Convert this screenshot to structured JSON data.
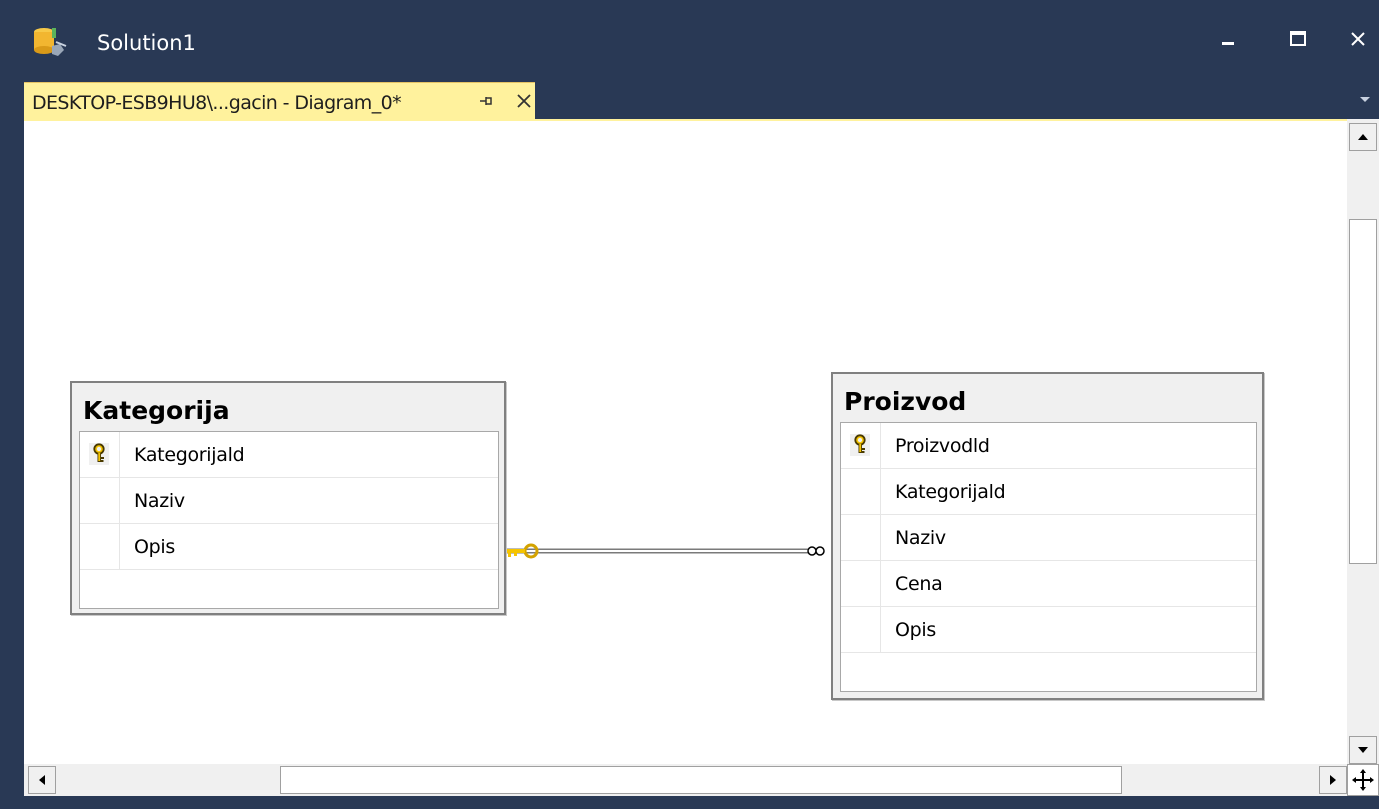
{
  "window": {
    "title": "Solution1",
    "minimize_glyph": "–",
    "maximize_glyph": "□",
    "close_glyph": "✕"
  },
  "tab": {
    "label": "DESKTOP-ESB9HU8\\...gacin - Diagram_0*",
    "pin_icon": "pin-icon",
    "close_icon": "close-icon",
    "active_color": "#fff29d"
  },
  "colors": {
    "chrome": "#293955",
    "canvas": "#ffffff",
    "key": "#f5c400"
  },
  "tables": [
    {
      "name": "Kategorija",
      "columns": [
        {
          "name": "Kategorijald",
          "primary_key": true
        },
        {
          "name": "Naziv",
          "primary_key": false
        },
        {
          "name": "Opis",
          "primary_key": false
        }
      ]
    },
    {
      "name": "Proizvod",
      "columns": [
        {
          "name": "Proizvodld",
          "primary_key": true
        },
        {
          "name": "Kategorijald",
          "primary_key": false
        },
        {
          "name": "Naziv",
          "primary_key": false
        },
        {
          "name": "Cena",
          "primary_key": false
        },
        {
          "name": "Opis",
          "primary_key": false
        }
      ]
    }
  ],
  "relationship": {
    "from": "Kategorija",
    "to": "Proizvod",
    "from_end": "one (key)",
    "to_end": "many (infinity)"
  }
}
